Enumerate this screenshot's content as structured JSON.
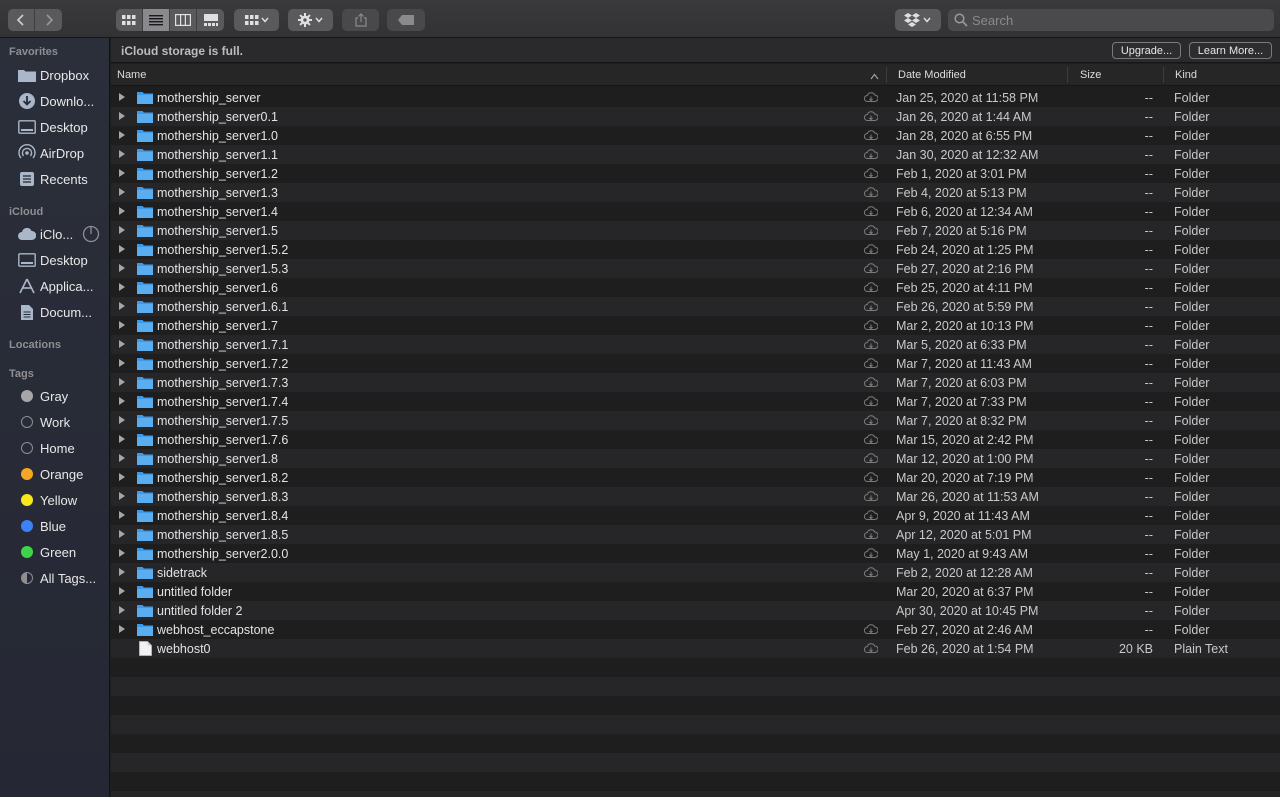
{
  "toolbar": {
    "search_placeholder": "Search",
    "icons": [
      "chevron-left-icon",
      "chevron-right-icon",
      "icon-view-icon",
      "list-view-icon",
      "column-view-icon",
      "gallery-view-icon",
      "group-icon",
      "gear-icon",
      "share-icon",
      "tag-icon",
      "dropbox-icon",
      "search-icon"
    ]
  },
  "sidebar": {
    "favorites_label": "Favorites",
    "favorites": [
      {
        "label": "Dropbox",
        "icon": "folder-icon"
      },
      {
        "label": "Downlo...",
        "icon": "download-icon"
      },
      {
        "label": "Desktop",
        "icon": "desktop-icon"
      },
      {
        "label": "AirDrop",
        "icon": "airdrop-icon"
      },
      {
        "label": "Recents",
        "icon": "recents-icon"
      }
    ],
    "icloud_label": "iCloud",
    "icloud": [
      {
        "label": "iClo...",
        "icon": "icloud-icon"
      },
      {
        "label": "Desktop",
        "icon": "desktop-icon"
      },
      {
        "label": "Applica...",
        "icon": "applications-icon"
      },
      {
        "label": "Docum...",
        "icon": "document-icon"
      }
    ],
    "locations_label": "Locations",
    "tags_label": "Tags",
    "tags": [
      {
        "label": "Gray",
        "color": "#a7a7a7",
        "filled": true
      },
      {
        "label": "Work",
        "color": "#8e8e93",
        "filled": false
      },
      {
        "label": "Home",
        "color": "#8e8e93",
        "filled": false
      },
      {
        "label": "Orange",
        "color": "#f5a623",
        "filled": true
      },
      {
        "label": "Yellow",
        "color": "#f8e71c",
        "filled": true
      },
      {
        "label": "Blue",
        "color": "#3b82f6",
        "filled": true
      },
      {
        "label": "Green",
        "color": "#3dd44a",
        "filled": true
      },
      {
        "label": "All Tags...",
        "color": "#8e8e93",
        "filled": false,
        "all": true
      }
    ]
  },
  "banner": {
    "message": "iCloud storage is full.",
    "upgrade_label": "Upgrade...",
    "learn_more_label": "Learn More..."
  },
  "columns": {
    "name": "Name",
    "date_modified": "Date Modified",
    "size": "Size",
    "kind": "Kind"
  },
  "files": [
    {
      "name": "mothership_server",
      "date": "Jan 25, 2020 at 11:58 PM",
      "size": "--",
      "kind": "Folder",
      "type": "folder",
      "cloud": true
    },
    {
      "name": "mothership_server0.1",
      "date": "Jan 26, 2020 at 1:44 AM",
      "size": "--",
      "kind": "Folder",
      "type": "folder",
      "cloud": true
    },
    {
      "name": "mothership_server1.0",
      "date": "Jan 28, 2020 at 6:55 PM",
      "size": "--",
      "kind": "Folder",
      "type": "folder",
      "cloud": true
    },
    {
      "name": "mothership_server1.1",
      "date": "Jan 30, 2020 at 12:32 AM",
      "size": "--",
      "kind": "Folder",
      "type": "folder",
      "cloud": true
    },
    {
      "name": "mothership_server1.2",
      "date": "Feb 1, 2020 at 3:01 PM",
      "size": "--",
      "kind": "Folder",
      "type": "folder",
      "cloud": true
    },
    {
      "name": "mothership_server1.3",
      "date": "Feb 4, 2020 at 5:13 PM",
      "size": "--",
      "kind": "Folder",
      "type": "folder",
      "cloud": true
    },
    {
      "name": "mothership_server1.4",
      "date": "Feb 6, 2020 at 12:34 AM",
      "size": "--",
      "kind": "Folder",
      "type": "folder",
      "cloud": true
    },
    {
      "name": "mothership_server1.5",
      "date": "Feb 7, 2020 at 5:16 PM",
      "size": "--",
      "kind": "Folder",
      "type": "folder",
      "cloud": true
    },
    {
      "name": "mothership_server1.5.2",
      "date": "Feb 24, 2020 at 1:25 PM",
      "size": "--",
      "kind": "Folder",
      "type": "folder",
      "cloud": true
    },
    {
      "name": "mothership_server1.5.3",
      "date": "Feb 27, 2020 at 2:16 PM",
      "size": "--",
      "kind": "Folder",
      "type": "folder",
      "cloud": true
    },
    {
      "name": "mothership_server1.6",
      "date": "Feb 25, 2020 at 4:11 PM",
      "size": "--",
      "kind": "Folder",
      "type": "folder",
      "cloud": true
    },
    {
      "name": "mothership_server1.6.1",
      "date": "Feb 26, 2020 at 5:59 PM",
      "size": "--",
      "kind": "Folder",
      "type": "folder",
      "cloud": true
    },
    {
      "name": "mothership_server1.7",
      "date": "Mar 2, 2020 at 10:13 PM",
      "size": "--",
      "kind": "Folder",
      "type": "folder",
      "cloud": true
    },
    {
      "name": "mothership_server1.7.1",
      "date": "Mar 5, 2020 at 6:33 PM",
      "size": "--",
      "kind": "Folder",
      "type": "folder",
      "cloud": true
    },
    {
      "name": "mothership_server1.7.2",
      "date": "Mar 7, 2020 at 11:43 AM",
      "size": "--",
      "kind": "Folder",
      "type": "folder",
      "cloud": true
    },
    {
      "name": "mothership_server1.7.3",
      "date": "Mar 7, 2020 at 6:03 PM",
      "size": "--",
      "kind": "Folder",
      "type": "folder",
      "cloud": true
    },
    {
      "name": "mothership_server1.7.4",
      "date": "Mar 7, 2020 at 7:33 PM",
      "size": "--",
      "kind": "Folder",
      "type": "folder",
      "cloud": true
    },
    {
      "name": "mothership_server1.7.5",
      "date": "Mar 7, 2020 at 8:32 PM",
      "size": "--",
      "kind": "Folder",
      "type": "folder",
      "cloud": true
    },
    {
      "name": "mothership_server1.7.6",
      "date": "Mar 15, 2020 at 2:42 PM",
      "size": "--",
      "kind": "Folder",
      "type": "folder",
      "cloud": true
    },
    {
      "name": "mothership_server1.8",
      "date": "Mar 12, 2020 at 1:00 PM",
      "size": "--",
      "kind": "Folder",
      "type": "folder",
      "cloud": true
    },
    {
      "name": "mothership_server1.8.2",
      "date": "Mar 20, 2020 at 7:19 PM",
      "size": "--",
      "kind": "Folder",
      "type": "folder",
      "cloud": true
    },
    {
      "name": "mothership_server1.8.3",
      "date": "Mar 26, 2020 at 11:53 AM",
      "size": "--",
      "kind": "Folder",
      "type": "folder",
      "cloud": true
    },
    {
      "name": "mothership_server1.8.4",
      "date": "Apr 9, 2020 at 11:43 AM",
      "size": "--",
      "kind": "Folder",
      "type": "folder",
      "cloud": true
    },
    {
      "name": "mothership_server1.8.5",
      "date": "Apr 12, 2020 at 5:01 PM",
      "size": "--",
      "kind": "Folder",
      "type": "folder",
      "cloud": true
    },
    {
      "name": "mothership_server2.0.0",
      "date": "May 1, 2020 at 9:43 AM",
      "size": "--",
      "kind": "Folder",
      "type": "folder",
      "cloud": true
    },
    {
      "name": "sidetrack",
      "date": "Feb 2, 2020 at 12:28 AM",
      "size": "--",
      "kind": "Folder",
      "type": "folder",
      "cloud": true
    },
    {
      "name": "untitled folder",
      "date": "Mar 20, 2020 at 6:37 PM",
      "size": "--",
      "kind": "Folder",
      "type": "folder",
      "cloud": false
    },
    {
      "name": "untitled folder 2",
      "date": "Apr 30, 2020 at 10:45 PM",
      "size": "--",
      "kind": "Folder",
      "type": "folder",
      "cloud": false
    },
    {
      "name": "webhost_eccapstone",
      "date": "Feb 27, 2020 at 2:46 AM",
      "size": "--",
      "kind": "Folder",
      "type": "folder",
      "cloud": true
    },
    {
      "name": "webhost0",
      "date": "Feb 26, 2020 at 1:54 PM",
      "size": "20 KB",
      "kind": "Plain Text",
      "type": "file",
      "cloud": true
    }
  ],
  "colors": {
    "folder": "#3d9ae8",
    "accent": "#3b82f6"
  }
}
